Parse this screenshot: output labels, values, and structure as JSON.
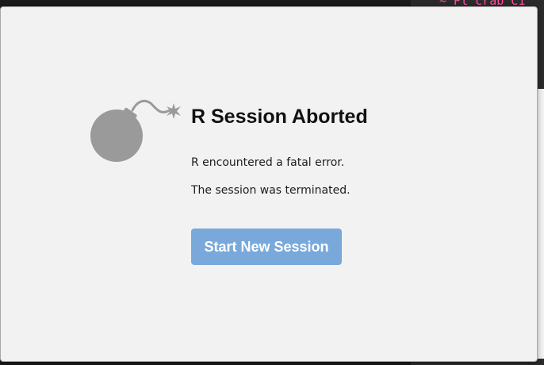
{
  "dialog": {
    "title": "R Session Aborted",
    "message_lines": [
      "R encountered a fatal error.",
      "The session was terminated."
    ],
    "primary_button_label": "Start New Session",
    "icon": "bomb-icon"
  },
  "colors": {
    "dialog_background": "#f2f2f2",
    "button_background": "#79a9db",
    "button_text": "#ffffff",
    "icon_gray": "#9a9a9a",
    "backdrop_dark": "#2b2b2b",
    "code_pink": "#ff4fa3"
  }
}
